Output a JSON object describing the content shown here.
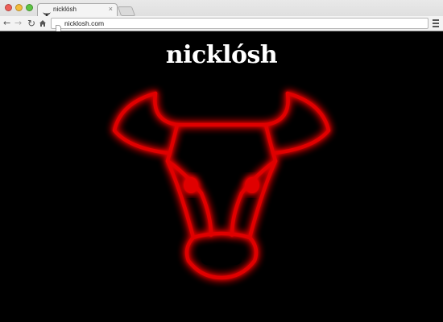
{
  "browser": {
    "tab_title": "nicklósh",
    "tab_close": "×",
    "url": "nicklosh.com"
  },
  "page": {
    "site_title": "nicklósh"
  },
  "colors": {
    "background": "#000000",
    "logo_stroke": "#e00000",
    "logo_glow": "#ff2020",
    "title_text": "#ffffff"
  },
  "icons": {
    "tab_favicon": "bull-head-icon",
    "logo": "bull-head-logo"
  }
}
